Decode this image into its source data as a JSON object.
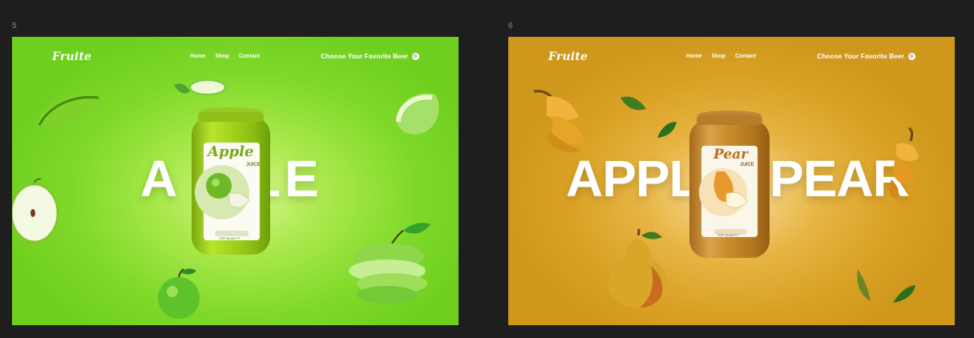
{
  "frames": [
    {
      "id": "5",
      "label": "5",
      "theme": "apple",
      "colors": {
        "bg": "#7fd92a",
        "can": "#9cd31c"
      },
      "nav": {
        "logo": "Fruite",
        "links": [
          "Home",
          "Shop",
          "Contact"
        ],
        "cta": "Choose Your Favorite Beer"
      },
      "hero_word_left": "A",
      "hero_word_left2": "L",
      "hero_word_right": "E",
      "can": {
        "title": "Apple",
        "subtitle": "JUICE",
        "tag": "TOP QUALITY"
      }
    },
    {
      "id": "6",
      "label": "6",
      "theme": "pear",
      "colors": {
        "bg": "#d9a124",
        "can": "#c98a2a"
      },
      "nav": {
        "logo": "Fruite",
        "links": [
          "Home",
          "Shop",
          "Contact"
        ],
        "cta": "Choose Your Favorite Beer"
      },
      "hero_word_left": "APPL",
      "hero_word_right": "PEAR",
      "can": {
        "title": "Pear",
        "subtitle": "JUICE",
        "tag": "TOP QUALITY"
      }
    }
  ]
}
